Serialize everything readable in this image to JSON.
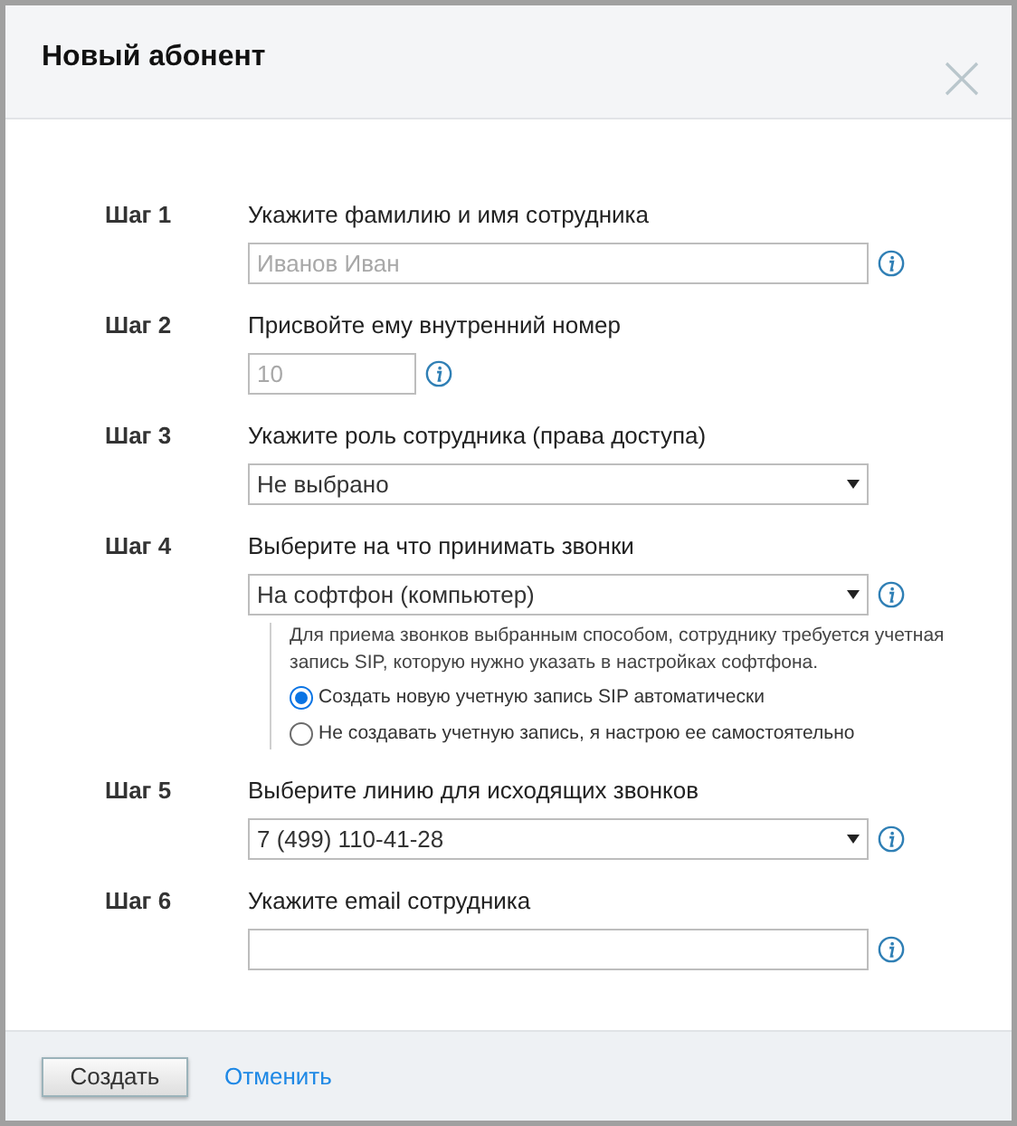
{
  "dialog": {
    "title": "Новый абонент"
  },
  "steps": [
    {
      "label": "Шаг 1",
      "prompt": "Укажите фамилию и имя сотрудника",
      "field": {
        "kind": "text",
        "placeholder": "Иванов Иван"
      },
      "info": true
    },
    {
      "label": "Шаг 2",
      "prompt": "Присвойте ему внутренний номер",
      "field": {
        "kind": "short_text",
        "placeholder": "10"
      },
      "info": true
    },
    {
      "label": "Шаг 3",
      "prompt": "Укажите роль сотрудника (права доступа)",
      "field": {
        "kind": "select",
        "value": "Не выбрано"
      },
      "info": false
    },
    {
      "label": "Шаг 4",
      "prompt": "Выберите на что принимать звонки",
      "field": {
        "kind": "select",
        "value": "На софтфон (компьютер)"
      },
      "info": true,
      "note": {
        "text": "Для приема звонков выбранным способом, сотруднику требуется учетная запись SIP, которую нужно указать в настройках софтфона.",
        "options": [
          {
            "label": "Создать новую учетную запись SIP автоматически",
            "selected": true
          },
          {
            "label": "Не создавать учетную запись, я настрою ее самостоятельно",
            "selected": false
          }
        ]
      }
    },
    {
      "label": "Шаг 5",
      "prompt": "Выберите линию для исходящих звонков",
      "field": {
        "kind": "select",
        "value": "7 (499) 110-41-28"
      },
      "info": true
    },
    {
      "label": "Шаг 6",
      "prompt": "Укажите email сотрудника",
      "field": {
        "kind": "text"
      },
      "info": true
    }
  ],
  "footer": {
    "primary": "Создать",
    "cancel": "Отменить"
  }
}
